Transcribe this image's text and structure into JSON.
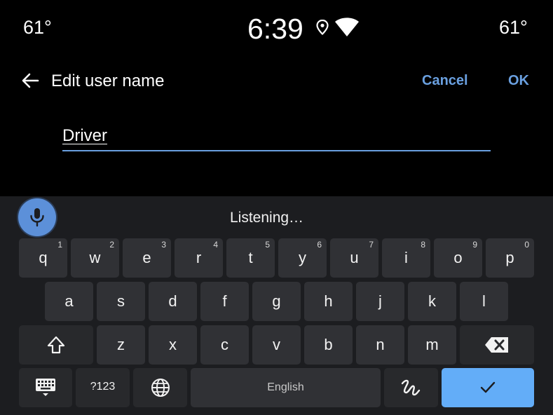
{
  "status_bar": {
    "temp_left": "61°",
    "clock": "6:39",
    "temp_right": "61°",
    "icons": [
      "location-pin-icon",
      "wifi-icon"
    ]
  },
  "app_bar": {
    "title": "Edit user name",
    "cancel_label": "Cancel",
    "ok_label": "OK"
  },
  "text_field": {
    "value": "Driver"
  },
  "keyboard": {
    "status": "Listening…",
    "row1": [
      {
        "key": "q",
        "hint": "1"
      },
      {
        "key": "w",
        "hint": "2"
      },
      {
        "key": "e",
        "hint": "3"
      },
      {
        "key": "r",
        "hint": "4"
      },
      {
        "key": "t",
        "hint": "5"
      },
      {
        "key": "y",
        "hint": "6"
      },
      {
        "key": "u",
        "hint": "7"
      },
      {
        "key": "i",
        "hint": "8"
      },
      {
        "key": "o",
        "hint": "9"
      },
      {
        "key": "p",
        "hint": "0"
      }
    ],
    "row2": [
      "a",
      "s",
      "d",
      "f",
      "g",
      "h",
      "j",
      "k",
      "l"
    ],
    "row3": [
      "z",
      "x",
      "c",
      "v",
      "b",
      "n",
      "m"
    ],
    "symbols_label": "?123",
    "space_label": "English"
  },
  "colors": {
    "accent": "#6aa0e0",
    "enter_key": "#63adf8",
    "mic": "#5c90d9",
    "keyboard_bg": "#1c1d20",
    "key_bg": "#303135"
  }
}
